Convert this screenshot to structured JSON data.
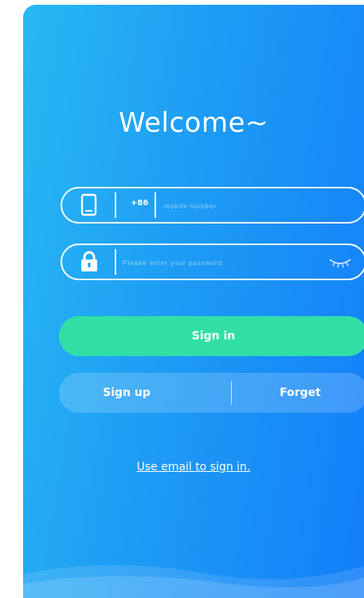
{
  "header": {
    "title": "Welcome~"
  },
  "phone_field": {
    "country_code": "+86",
    "placeholder": "mobile number",
    "icon": "phone-icon"
  },
  "password_field": {
    "placeholder": "Please enter your password",
    "icon": "lock-icon",
    "toggle_icon": "eye-closed-icon"
  },
  "actions": {
    "sign_in": "Sign in",
    "sign_up": "Sign up",
    "forget": "Forget"
  },
  "alt_login": {
    "email_link": "Use email to sign in."
  },
  "colors": {
    "gradient_start": "#27b8f2",
    "gradient_end": "#137ef9",
    "primary_button": "#31dfa6",
    "text": "#ffffff"
  }
}
